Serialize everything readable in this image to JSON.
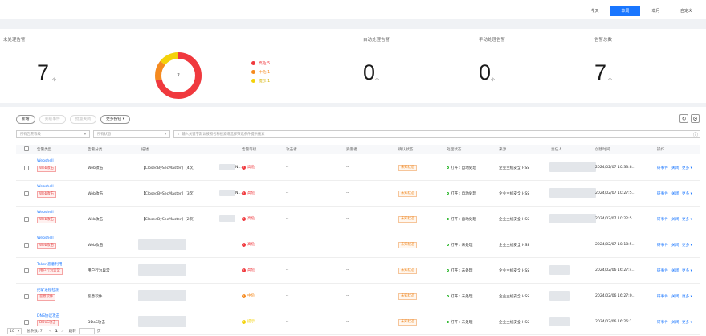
{
  "time_ranges": [
    "今天",
    "本周",
    "本月",
    "自定义"
  ],
  "active_range": 1,
  "stats": {
    "unhandled": {
      "title": "未处理告警",
      "value": "7",
      "unit": "个"
    },
    "auto": {
      "title": "自动处理告警",
      "value": "0",
      "unit": "个"
    },
    "manual": {
      "title": "手动处理告警",
      "value": "0",
      "unit": "个"
    },
    "total": {
      "title": "告警总数",
      "value": "7",
      "unit": "个"
    },
    "donut_center": "7",
    "legend": [
      {
        "label": "高危 5",
        "color": "#f0393e"
      },
      {
        "label": "中危 1",
        "color": "#f58a1f"
      },
      {
        "label": "提示 1",
        "color": "#f4d20a"
      }
    ]
  },
  "toolbar": {
    "new": "新增",
    "link_event": "关联事件",
    "batch_close": "批量关闭",
    "more": "更多按钮"
  },
  "filters": {
    "level": "所有告警等级",
    "status": "所有状态",
    "search_placeholder": "输入关键字默认按照名称搜索或选择筛选条件提供搜索"
  },
  "columns": [
    "告警类型",
    "告警分类",
    "描述",
    "告警等级",
    "攻击者",
    "受害者",
    "确认状态",
    "处理状态",
    "来源",
    "责任人",
    "创建时间",
    "操作"
  ],
  "rows": [
    {
      "type": "Webshell",
      "tag": "Web攻击",
      "tag_color": "red",
      "category": "Web攻击",
      "desc": "【ClosedBySecMaster】【4次】",
      "desc_tail": "N...",
      "level": "高危",
      "level_color": "#f0393e",
      "attacker": "--",
      "victim": "--",
      "confirm": "未知状态",
      "process": "打开 : 自动处理",
      "source": "企业主机安全 HSS",
      "owner_redacted": true,
      "created": "2024/02/07 10:33:8...",
      "ops": [
        "研事件",
        "关闭",
        "更多"
      ]
    },
    {
      "type": "Webshell",
      "tag": "Web攻击",
      "tag_color": "red",
      "category": "Web攻击",
      "desc": "【ClosedBySecMaster】【3次】",
      "desc_tail": "N...",
      "level": "高危",
      "level_color": "#f0393e",
      "attacker": "--",
      "victim": "--",
      "confirm": "未知状态",
      "process": "打开 : 自动处理",
      "source": "企业主机安全 HSS",
      "owner_redacted": true,
      "created": "2024/02/07 10:27:5...",
      "ops": [
        "研事件",
        "关闭",
        "更多"
      ]
    },
    {
      "type": "Webshell",
      "tag": "Web攻击",
      "tag_color": "red",
      "category": "Web攻击",
      "desc": "【ClosedBySecMaster】【2次】",
      "desc_tail": "",
      "level": "高危",
      "level_color": "#f0393e",
      "attacker": "--",
      "victim": "--",
      "confirm": "未知状态",
      "process": "打开 : 自动处理",
      "source": "企业主机安全 HSS",
      "owner_redacted": true,
      "created": "2024/02/07 10:22:5...",
      "ops": [
        "研事件",
        "关闭",
        "更多"
      ]
    },
    {
      "type": "Webshell",
      "tag": "Web攻击",
      "tag_color": "red",
      "category": "Web攻击",
      "desc": "",
      "desc_tail": "",
      "level": "高危",
      "level_color": "#f0393e",
      "attacker": "--",
      "victim": "--",
      "confirm": "未知状态",
      "process": "打开 : 未处理",
      "source": "企业主机安全 HSS",
      "owner": "--",
      "created": "2024/02/07 10:18:5...",
      "ops": [
        "研事件",
        "关闭",
        "更多"
      ]
    },
    {
      "type": "Token恶意利用",
      "tag": "用户行为异常",
      "tag_color": "red",
      "category": "用户行为异常",
      "desc": "",
      "desc_tail": "",
      "level": "高危",
      "level_color": "#f0393e",
      "attacker": "--",
      "victim": "--",
      "confirm": "未知状态",
      "process": "打开 : 未处理",
      "source": "企业主机安全 HSS",
      "owner_redacted": true,
      "created": "2024/02/06 16:27:4...",
      "ops": [
        "研事件",
        "关闭",
        "更多"
      ]
    },
    {
      "type": "挖矿进程检测",
      "tag": "恶意软件",
      "tag_color": "red",
      "category": "恶意软件",
      "desc": "",
      "desc_tail": "",
      "level": "中危",
      "level_color": "#f58a1f",
      "attacker": "--",
      "victim": "--",
      "confirm": "未知状态",
      "process": "打开 : 未处理",
      "source": "企业主机安全 HSS",
      "owner_redacted": true,
      "created": "2024/02/06 16:27:0...",
      "ops": [
        "研事件",
        "关闭",
        "更多"
      ]
    },
    {
      "type": "DNS协议攻击",
      "tag": "DDoS攻击",
      "tag_color": "red",
      "category": "DDoS攻击",
      "desc": "",
      "desc_tail": "",
      "level": "提示",
      "level_color": "#f4d20a",
      "attacker": "--",
      "victim": "--",
      "confirm": "未知状态",
      "process": "打开 : 未处理",
      "source": "企业主机安全 HSS",
      "owner_redacted": true,
      "created": "2024/02/06 16:26:1...",
      "ops": [
        "研事件",
        "关闭",
        "更多"
      ]
    }
  ],
  "footer": {
    "page_size": "10",
    "total": "总条数: 7",
    "prev": "<",
    "page": "1",
    "next": ">",
    "goto": "跳转",
    "page_unit": "页"
  }
}
